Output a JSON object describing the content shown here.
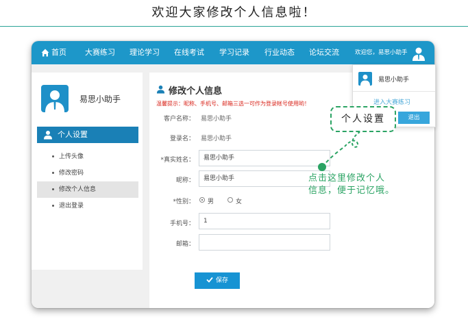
{
  "banner": {
    "title": "欢迎大家修改个人信息啦！"
  },
  "nav": {
    "items": [
      "首页",
      "大赛练习",
      "理论学习",
      "在线考试",
      "学习记录",
      "行业动态",
      "论坛交流"
    ],
    "welcome": "欢迎您，易思小助手"
  },
  "sidebar": {
    "username": "易思小助手",
    "section_title": "个人设置",
    "links": [
      "上传头像",
      "修改密码",
      "修改个人信息",
      "退出登录"
    ],
    "active_index": 2
  },
  "content": {
    "title": "修改个人信息",
    "tip": "温馨提示：昵称、手机号、邮箱三选一可作为登录帐号使用哟！",
    "fields": {
      "customer_name": {
        "label": "客户名称：",
        "value": "易思小助手"
      },
      "login_name": {
        "label": "登录名：",
        "value": "易思小助手"
      },
      "real_name": {
        "label": "*真实姓名：",
        "value": "易思小助手"
      },
      "nickname": {
        "label": "昵称：",
        "value": "易思小助手"
      },
      "gender": {
        "label": "*性别：",
        "options": [
          "男",
          "女"
        ],
        "selected": "男"
      },
      "phone": {
        "label": "手机号：",
        "value": "1"
      },
      "email": {
        "label": "邮箱：",
        "value": ""
      }
    },
    "save_label": "保存"
  },
  "dropdown": {
    "username": "易思小助手",
    "link": "进入大赛练习",
    "logout_label": "退出"
  },
  "callout": {
    "label": "个人设置",
    "hint_lines": [
      "点击这里修改个人",
      "信息，便于记忆哦。"
    ]
  },
  "colors": {
    "nav_blue": "#1d97c9",
    "sidebar_section": "#1a80b6",
    "accent_green": "#2aa363",
    "tip_red": "#d9261c"
  }
}
